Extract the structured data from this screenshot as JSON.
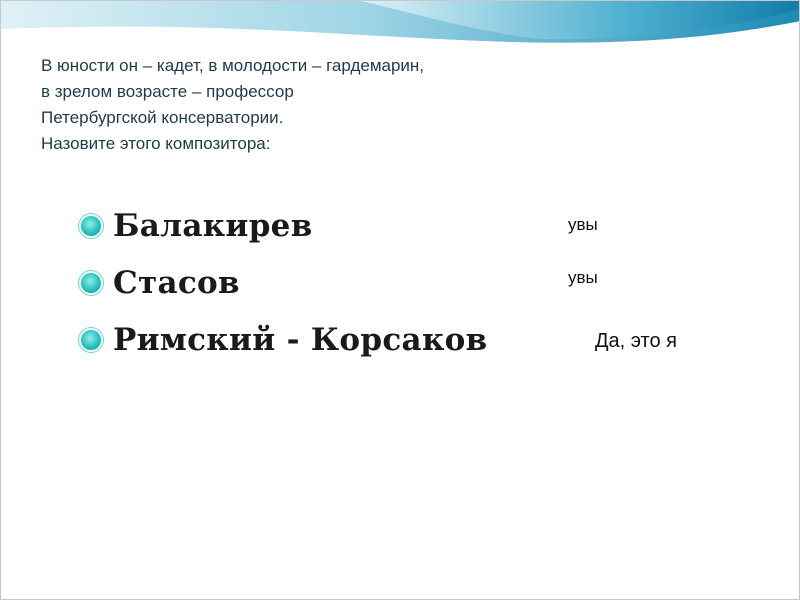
{
  "slide": {
    "question": "В юности он – кадет, в молодости – гардемарин,\nв зрелом возрасте – профессор\nПетербургской консерватории.\nНазовите этого композитора:",
    "options": [
      {
        "label": "Балакирев",
        "reply": "увы"
      },
      {
        "label": "Стасов",
        "reply": "увы"
      },
      {
        "label": "Римский - Корсаков",
        "reply": "Да, это я"
      }
    ],
    "colors": {
      "wave_dark": "#1e8fb6",
      "wave_light": "#bfe4ef",
      "bullet": "#2bbfbf"
    },
    "icons": {
      "bullet": "teal-circle-bullet-icon"
    }
  }
}
